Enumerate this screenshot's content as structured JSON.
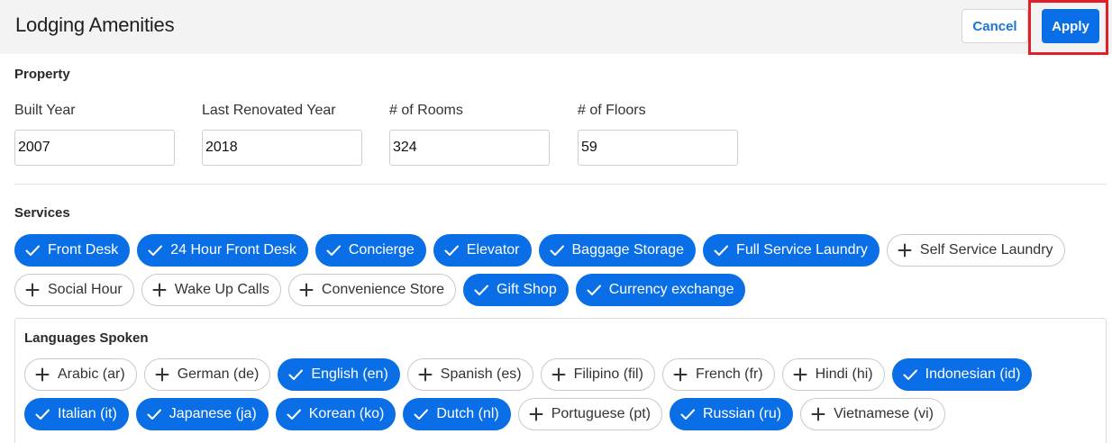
{
  "header": {
    "title": "Lodging Amenities",
    "cancel_label": "Cancel",
    "apply_label": "Apply"
  },
  "property": {
    "section_title": "Property",
    "fields": [
      {
        "label": "Built Year",
        "value": "2007"
      },
      {
        "label": "Last Renovated Year",
        "value": "2018"
      },
      {
        "label": "# of Rooms",
        "value": "324"
      },
      {
        "label": "# of Floors",
        "value": "59"
      }
    ]
  },
  "services": {
    "section_title": "Services",
    "items": [
      {
        "label": "Front Desk",
        "selected": true
      },
      {
        "label": "24 Hour Front Desk",
        "selected": true
      },
      {
        "label": "Concierge",
        "selected": true
      },
      {
        "label": "Elevator",
        "selected": true
      },
      {
        "label": "Baggage Storage",
        "selected": true
      },
      {
        "label": "Full Service Laundry",
        "selected": true
      },
      {
        "label": "Self Service Laundry",
        "selected": false
      },
      {
        "label": "Social Hour",
        "selected": false
      },
      {
        "label": "Wake Up Calls",
        "selected": false
      },
      {
        "label": "Convenience Store",
        "selected": false
      },
      {
        "label": "Gift Shop",
        "selected": true
      },
      {
        "label": "Currency exchange",
        "selected": true
      }
    ]
  },
  "languages": {
    "section_title": "Languages Spoken",
    "items": [
      {
        "label": "Arabic (ar)",
        "selected": false
      },
      {
        "label": "German (de)",
        "selected": false
      },
      {
        "label": "English (en)",
        "selected": true
      },
      {
        "label": "Spanish (es)",
        "selected": false
      },
      {
        "label": "Filipino (fil)",
        "selected": false
      },
      {
        "label": "French (fr)",
        "selected": false
      },
      {
        "label": "Hindi (hi)",
        "selected": false
      },
      {
        "label": "Indonesian (id)",
        "selected": true
      },
      {
        "label": "Italian (it)",
        "selected": true
      },
      {
        "label": "Japanese (ja)",
        "selected": true
      },
      {
        "label": "Korean (ko)",
        "selected": true
      },
      {
        "label": "Dutch (nl)",
        "selected": true
      },
      {
        "label": "Portuguese (pt)",
        "selected": false
      },
      {
        "label": "Russian (ru)",
        "selected": true
      },
      {
        "label": "Vietnamese (vi)",
        "selected": false
      }
    ]
  },
  "colors": {
    "accent": "#0a6fe6",
    "highlight": "#e3202a",
    "header_bg": "#f3f3f3"
  },
  "icons": {
    "selected": "check-icon",
    "unselected": "plus-icon"
  }
}
